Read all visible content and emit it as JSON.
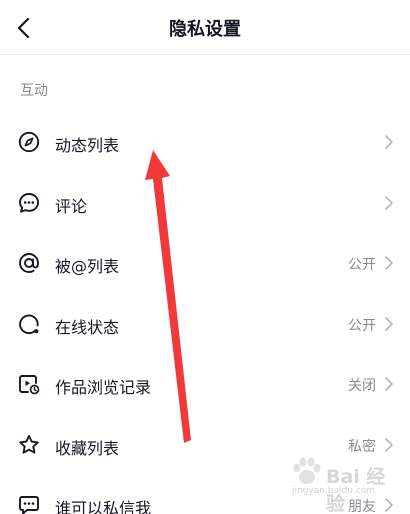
{
  "header": {
    "title": "隐私设置",
    "back_icon": "chevron-left-icon"
  },
  "section": {
    "label": "互动"
  },
  "items": [
    {
      "label": "动态列表",
      "value": "",
      "icon": "compass-icon"
    },
    {
      "label": "评论",
      "value": "",
      "icon": "comment-icon"
    },
    {
      "label": "被@列表",
      "value": "公开",
      "icon": "at-icon"
    },
    {
      "label": "在线状态",
      "value": "公开",
      "icon": "online-status-icon"
    },
    {
      "label": "作品浏览记录",
      "value": "关闭",
      "icon": "video-history-icon"
    },
    {
      "label": "收藏列表",
      "value": "私密",
      "icon": "star-icon"
    },
    {
      "label": "谁可以私信我",
      "value": "朋友",
      "icon": "message-icon"
    }
  ],
  "colors": {
    "text": "#161823",
    "secondary": "#8a8b91",
    "annotation_arrow": "#f03a3a"
  },
  "watermark": {
    "text": "Bai 经验",
    "sub": "jingyan.baidu.com"
  }
}
